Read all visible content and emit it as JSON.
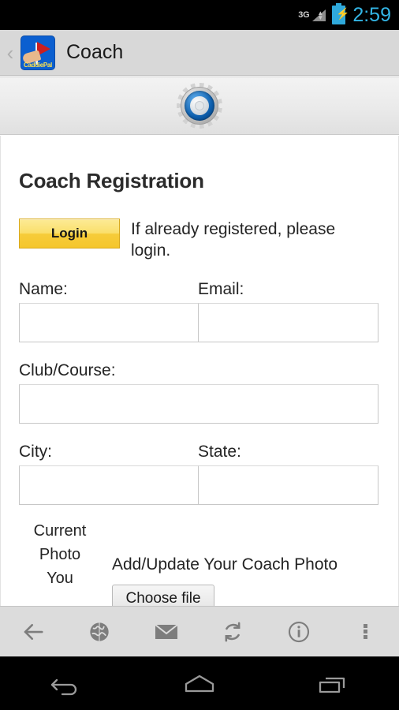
{
  "statusbar": {
    "network_label": "3G",
    "time": "2:59",
    "signal_icon": "signal-bars-icon",
    "battery_icon": "battery-charging-icon",
    "time_color": "#33b5e5"
  },
  "actionbar": {
    "back_icon": "back-chevron-icon",
    "app_icon_name": "caddiepal-app-icon",
    "app_icon_caption": "CaddiePal",
    "title": "Coach",
    "background": "#d8d8d8"
  },
  "banner": {
    "icon_name": "gear-icon",
    "background": "#eaeaea"
  },
  "page": {
    "title": "Coach Registration",
    "login_button": "Login",
    "login_note": "If already registered, please login.",
    "fields": {
      "name_label": "Name:",
      "name_value": "",
      "email_label": "Email:",
      "email_value": "",
      "club_label": "Club/Course:",
      "club_value": "",
      "city_label": "City:",
      "city_value": "",
      "state_label": "State:",
      "state_value": ""
    },
    "photo": {
      "current_photo_label": "Current Photo",
      "you_label": "You",
      "add_update_caption": "Add/Update Your Coach Photo",
      "choose_file_button": "Choose file"
    }
  },
  "toolbar": {
    "items": [
      {
        "name": "back-arrow-icon",
        "label": "Back"
      },
      {
        "name": "globe-icon",
        "label": "Browser"
      },
      {
        "name": "mail-icon",
        "label": "Mail"
      },
      {
        "name": "refresh-icon",
        "label": "Refresh"
      },
      {
        "name": "info-icon",
        "label": "Info"
      },
      {
        "name": "overflow-menu-icon",
        "label": "More"
      }
    ],
    "background": "#dcdcdc"
  },
  "navbar": {
    "back_label": "Back",
    "home_label": "Home",
    "recents_label": "Recent apps"
  }
}
